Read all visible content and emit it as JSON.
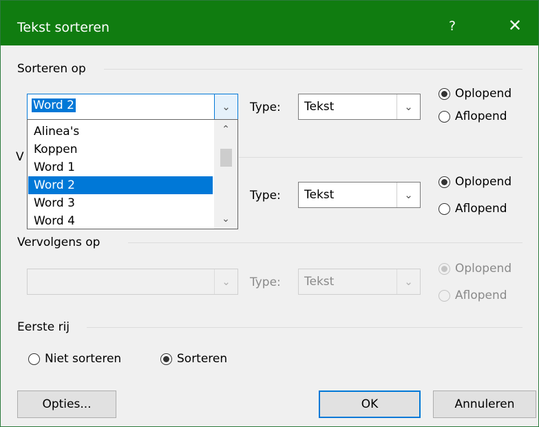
{
  "window": {
    "title": "Tekst sorteren",
    "help_label": "?",
    "close_label": "✕"
  },
  "sort_by": {
    "label": "Sorteren op",
    "field_value": "Word 2",
    "type_label": "Type:",
    "type_value": "Tekst",
    "ascending": "Oplopend",
    "descending": "Aflopend",
    "order": "ascending"
  },
  "dropdown_list": {
    "items": [
      "Alinea's",
      "Koppen",
      "Word 1",
      "Word 2",
      "Word 3",
      "Word 4"
    ],
    "selected": "Word 2"
  },
  "then_by_1": {
    "label_partial": "V",
    "type_label": "Type:",
    "type_value": "Tekst",
    "ascending": "Oplopend",
    "descending": "Aflopend",
    "order": "ascending"
  },
  "then_by_2": {
    "label": "Vervolgens op",
    "field_value": "",
    "type_label": "Type:",
    "type_value": "Tekst",
    "ascending": "Oplopend",
    "descending": "Aflopend",
    "disabled": true
  },
  "header_row": {
    "label": "Eerste rij",
    "no_sort": "Niet sorteren",
    "sort": "Sorteren",
    "selected": "sort"
  },
  "buttons": {
    "options": "Opties...",
    "ok": "OK",
    "cancel": "Annuleren"
  },
  "colors": {
    "title_bar": "#107c10",
    "selection": "#0078d7",
    "dialog_bg": "#f0f0f0"
  }
}
